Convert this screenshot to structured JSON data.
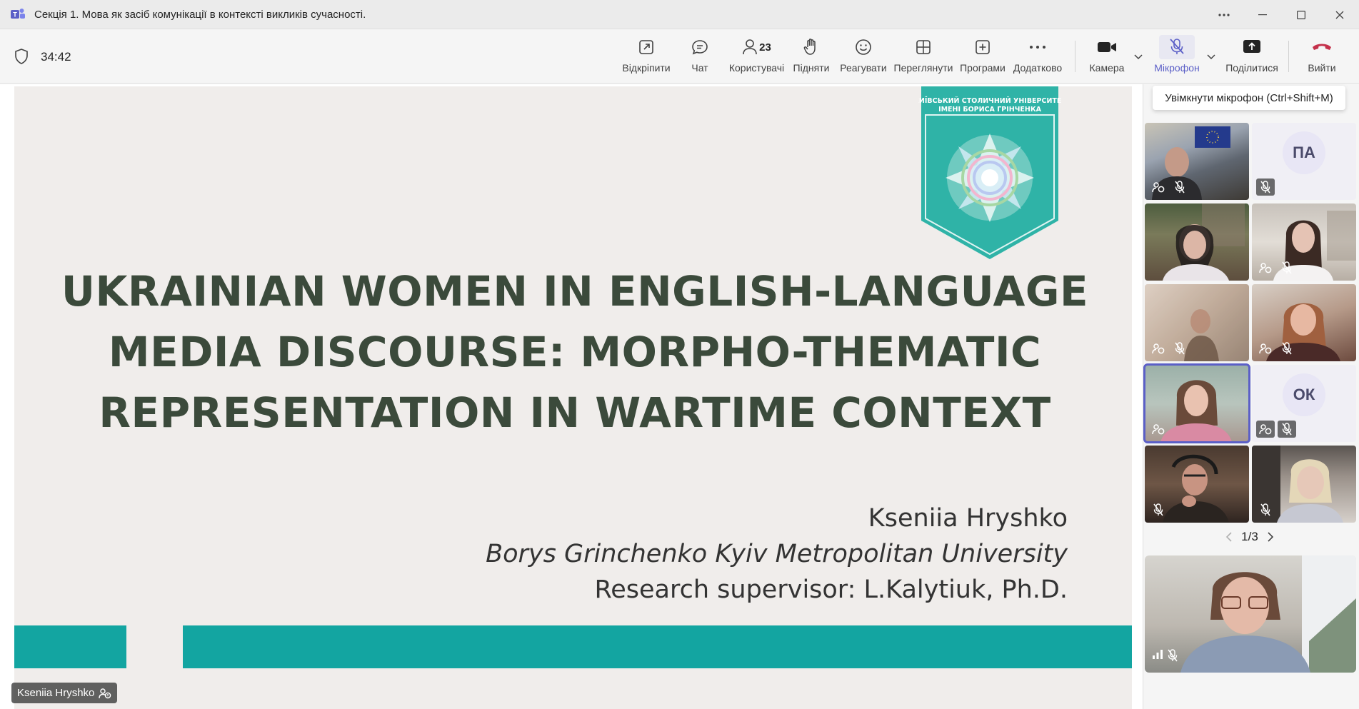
{
  "window": {
    "title": "Секція 1. Мова як засіб комунікації в контексті викликів сучасності.",
    "icon": "teams-icon",
    "controls": [
      "more-icon",
      "minimize-icon",
      "maximize-icon",
      "close-icon"
    ]
  },
  "toolbar": {
    "timer": "34:42",
    "items": {
      "unpin": "Відкріпити",
      "chat": "Чат",
      "people": "Користувачі",
      "people_count": "23",
      "raise": "Підняти",
      "react": "Реагувати",
      "view": "Переглянути",
      "apps": "Програми",
      "more": "Додатково",
      "camera": "Камера",
      "mic": "Мікрофон",
      "share": "Поділитися",
      "leave": "Вийти"
    },
    "tooltip": "Увімкнути мікрофон (Ctrl+Shift+M)"
  },
  "slide": {
    "emblem_text_line1": "КИЇВСЬКИЙ СТОЛИЧНИЙ УНІВЕРСИТЕТ",
    "emblem_text_line2": "ІМЕНІ БОРИСА ГРІНЧЕНКА",
    "title_lines": [
      "UKRAINIAN WOMEN IN ENGLISH-LANGUAGE",
      "MEDIA DISCOURSE: MORPHO-THEMATIC",
      "REPRESENTATION IN WARTIME CONTEXT"
    ],
    "author": "Kseniia Hryshko",
    "university": "Borys Grinchenko Kyiv Metropolitan University",
    "supervisor": "Research supervisor: L.Kalytiuk, Ph.D.",
    "accent_color": "#13a5a1",
    "title_color": "#3b4a3b"
  },
  "presenter_tag": "Kseniia Hryshko",
  "participants": {
    "initials": [
      "ПА",
      "ОК"
    ],
    "page": "1/3"
  },
  "colors": {
    "brand": "#5b5fc7",
    "leave": "#c4314b"
  }
}
